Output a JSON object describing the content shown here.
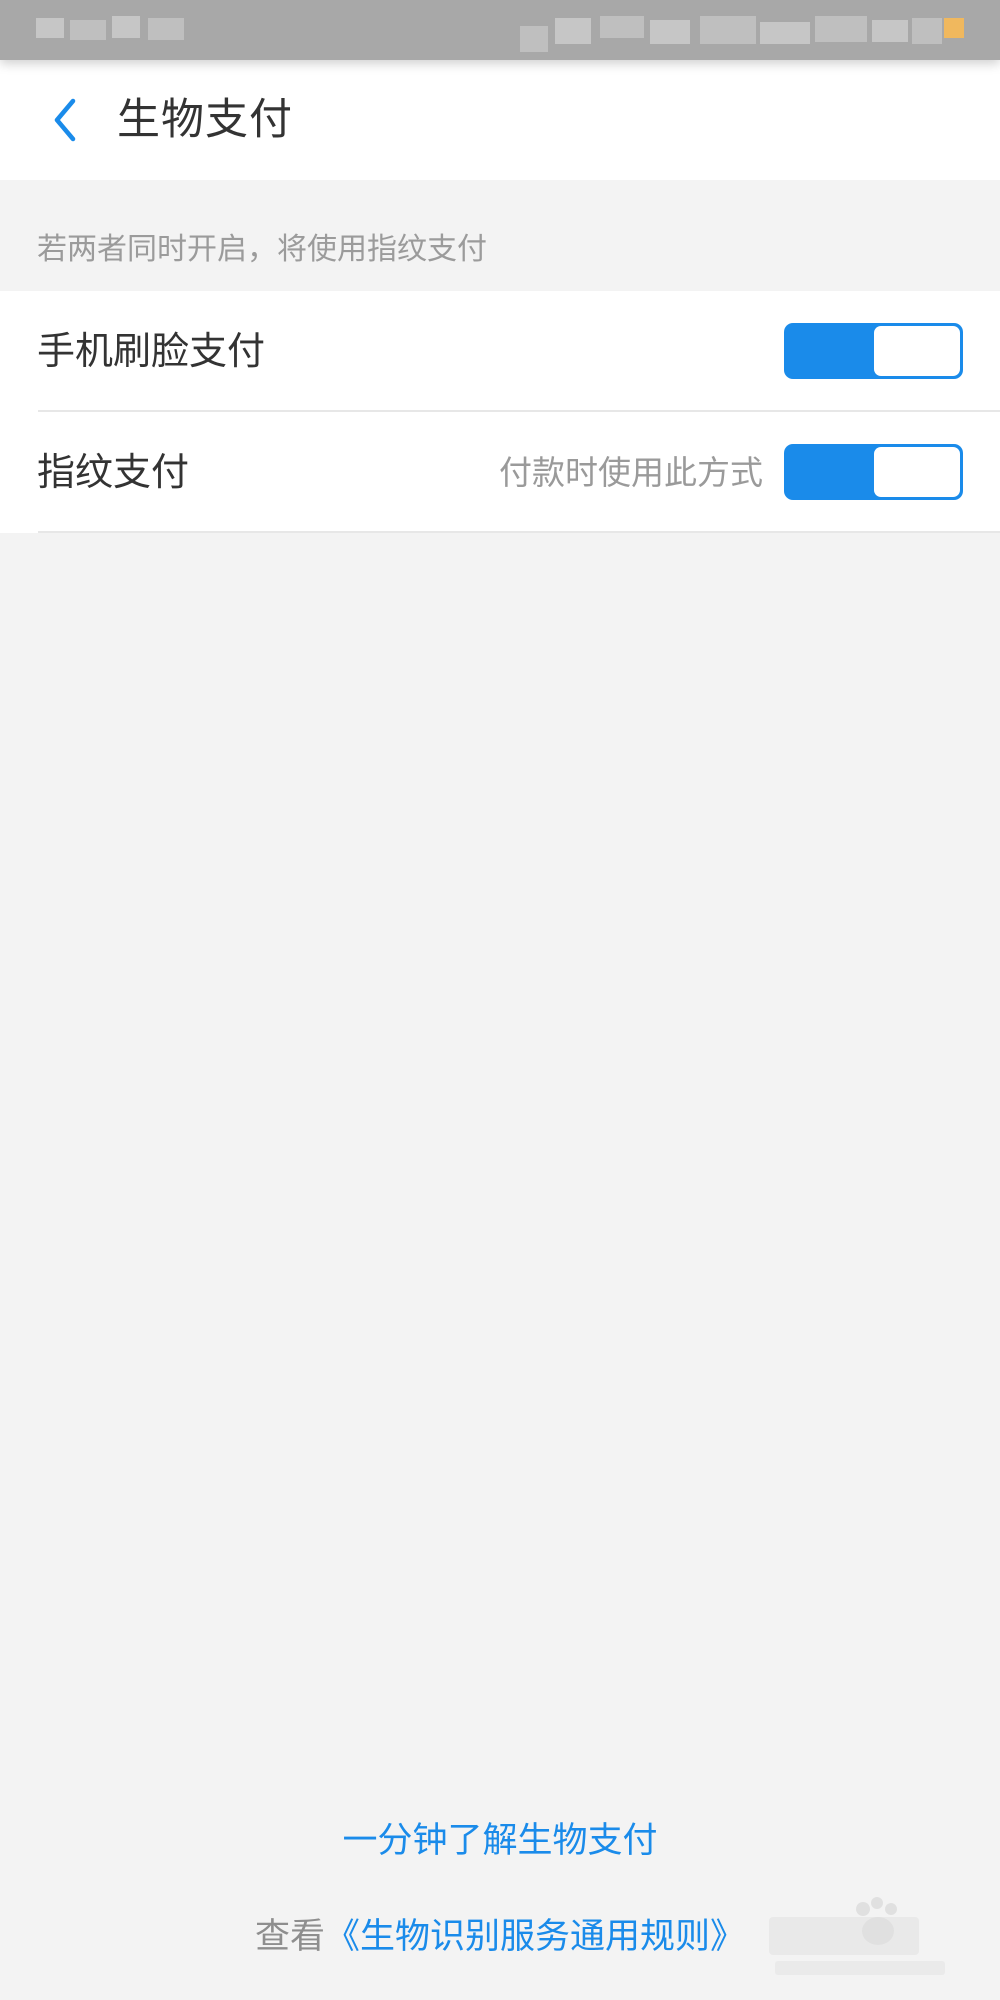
{
  "header": {
    "title": "生物支付"
  },
  "hint": "若两者同时开启，将使用指纹支付",
  "settings": [
    {
      "label": "手机刷脸支付",
      "sublabel": "",
      "enabled": true
    },
    {
      "label": "指纹支付",
      "sublabel": "付款时使用此方式",
      "enabled": true
    }
  ],
  "footer": {
    "learn_link": "一分钟了解生物支付",
    "rules_prefix": "查看",
    "rules_link": "《生物识别服务通用规则》"
  },
  "colors": {
    "accent": "#1a8bea",
    "background": "#f3f3f3",
    "text": "#333333",
    "secondary_text": "#9b9b9b"
  },
  "icons": {
    "back": "chevron-left-icon"
  }
}
